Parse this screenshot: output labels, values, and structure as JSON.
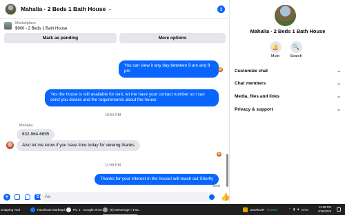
{
  "header": {
    "title": "Mahalia · 2 Beds 1 Bath House"
  },
  "listing": {
    "label": "Marketplace",
    "summary": "$900 - 2 Beds 1 Bath House",
    "mark_pending_label": "Mark as pending",
    "more_options_label": "More options"
  },
  "messages": {
    "m1": "You can view it any day between 9 am and 8 pm",
    "m2": "Yes the house is still available for rent, let me have your contact number so i can send you details and the requirements about the house",
    "time1": "10:50 PM",
    "sender": "Mahalia",
    "m3": "832-964-6695",
    "m4": "Also let me know if you have time today for viewing thanks",
    "time2": "11:38 PM",
    "m5": "Thanks for your interest in the house! will reach out Shortly",
    "status": "Sent"
  },
  "composer": {
    "placeholder": "Aa"
  },
  "info_panel": {
    "name": "Mahalia · 2 Beds 1 Bath House",
    "mute_label": "Mute",
    "search_label": "Search",
    "sections": [
      "Customize chat",
      "Chat members",
      "Media, files and links",
      "Privacy & support"
    ]
  },
  "taskbar": {
    "apps": [
      "Snipping Tool",
      "Facebook Marketpl...",
      "PC 1 - Google Shee...",
      "(5) Messenger | Fac..."
    ],
    "ticker_symbol": "USD/EUR",
    "ticker_change": "+0.03%",
    "language": "ENG",
    "time": "11:38 PM",
    "date": "3/26/2025"
  },
  "colors": {
    "accent": "#0866ff",
    "ticker_positive": "#3fc74a"
  }
}
